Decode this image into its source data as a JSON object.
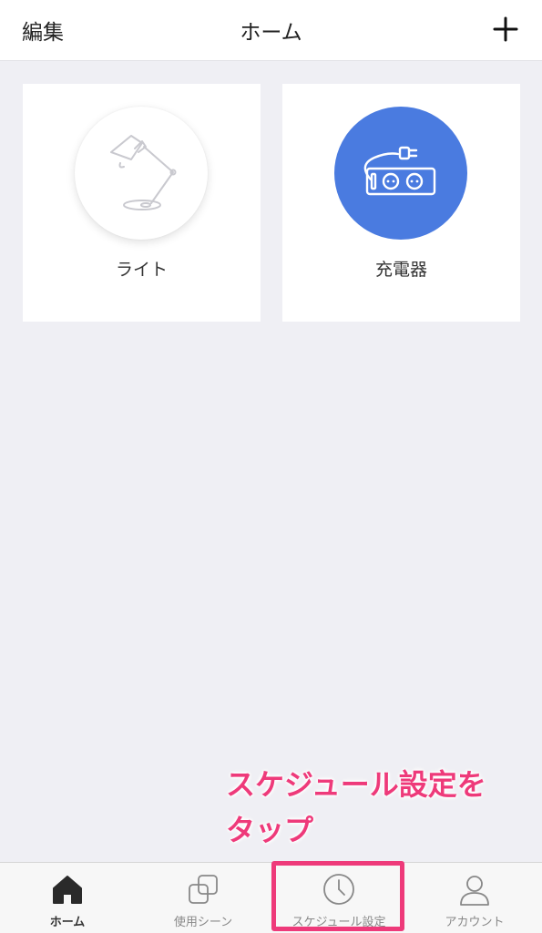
{
  "header": {
    "edit_label": "編集",
    "title": "ホーム",
    "add_icon": "plus-icon"
  },
  "devices": [
    {
      "label": "ライト",
      "icon": "desk-lamp-icon",
      "state": "off"
    },
    {
      "label": "充電器",
      "icon": "power-strip-icon",
      "state": "on",
      "accent": "#4a7be0"
    }
  ],
  "annotation": {
    "line1": "スケジュール設定を",
    "line2": "タップ",
    "color": "#ee3a7a"
  },
  "tabbar": {
    "tabs": [
      {
        "label": "ホーム",
        "icon": "home-icon",
        "active": true
      },
      {
        "label": "使用シーン",
        "icon": "scene-icon",
        "active": false
      },
      {
        "label": "スケジュール設定",
        "icon": "clock-icon",
        "active": false,
        "highlighted": true
      },
      {
        "label": "アカウント",
        "icon": "person-icon",
        "active": false
      }
    ]
  }
}
